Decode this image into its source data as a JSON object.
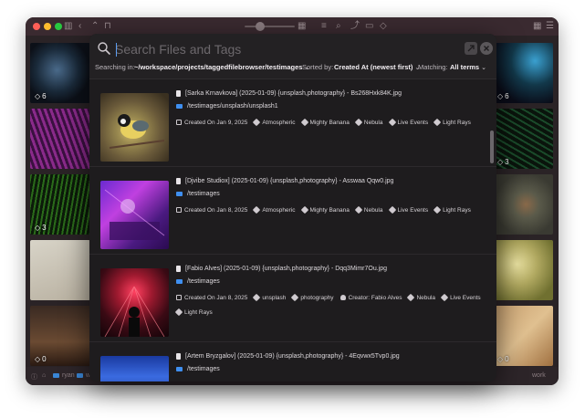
{
  "window": {
    "badges": [
      "6",
      "6",
      "3",
      "3",
      "0",
      "0"
    ]
  },
  "statusbar": {
    "crumb1": "ryan",
    "crumb2": "wo",
    "right": "work"
  },
  "search": {
    "placeholder": "Search Files and Tags",
    "value": ""
  },
  "filters": {
    "searching_label": "Searching in:",
    "path": "~/workspace/projects/taggedfilebrowser/testimages",
    "sorted_label": "Sorted by:",
    "sort_value": "Created At (newest first)",
    "matching_label": "Matching:",
    "matching_value": "All terms"
  },
  "results": [
    {
      "title": "[Sarka Krnavkova] (2025-01-09) {unsplash,photography} - Bs268Hxk84K.jpg",
      "path": "/testimages/unsplash/unsplash1",
      "created": "Created On Jan 9, 2025",
      "tags": [
        "Atmospheric",
        "Mighty Banana",
        "Nebula",
        "Live Events",
        "Light Rays"
      ]
    },
    {
      "title": "[Djvibe Studiox] (2025-01-09) {unsplash,photography} - Asswaa Qqw0.jpg",
      "path": "/testimages",
      "created": "Created On Jan 8, 2025",
      "tags": [
        "Atmospheric",
        "Mighty Banana",
        "Nebula",
        "Live Events",
        "Light Rays"
      ]
    },
    {
      "title": "[Fabio Alves] (2025-01-09) {unsplash,photography} - Dqq3Mimr7Ou.jpg",
      "path": "/testimages",
      "created": "Created On Jan 8, 2025",
      "tags": [
        "unsplash",
        "photography"
      ],
      "creator": "Creator: Fabio Alves",
      "tags2": [
        "Nebula",
        "Live Events",
        "Light Rays"
      ]
    },
    {
      "title": "[Artem Bryzgalov] (2025-01-09) {unsplash,photography} - 4Eqvwx5Tvp0.jpg",
      "path": "/testimages"
    }
  ],
  "colors": {
    "accent": "#3f8ff0",
    "dialog_bg": "#1e1c1e",
    "window_bg": "#2a2326"
  }
}
